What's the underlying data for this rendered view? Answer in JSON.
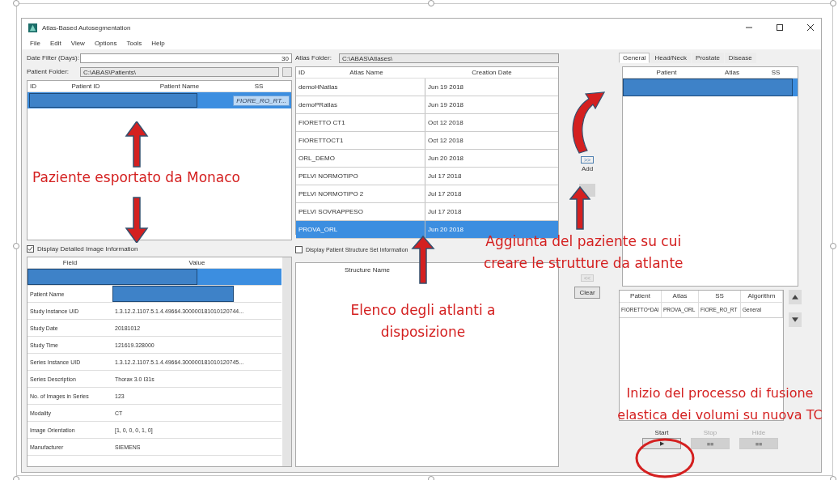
{
  "window": {
    "title": "Atlas-Based Autosegmentation"
  },
  "menu": [
    "File",
    "Edit",
    "View",
    "Options",
    "Tools",
    "Help"
  ],
  "date_filter": {
    "label": "Date Filter (Days):",
    "value": "30"
  },
  "patient_folder": {
    "label": "Patient Folder:",
    "value": "C:\\ABAS\\Patients\\"
  },
  "patients": {
    "columns": [
      "ID",
      "Patient ID",
      "Patient Name",
      "SS"
    ],
    "rows": [
      {
        "selected": true,
        "redacted": true,
        "ss": "FIORE_RO_RT..."
      }
    ]
  },
  "detailed_info": {
    "label": "Display Detailed Image Information",
    "checked": true,
    "columns": [
      "Field",
      "Value"
    ],
    "rows": [
      {
        "selected": true,
        "redacted": true
      },
      {
        "field": "Patient Name",
        "selected": false,
        "redacted": true
      },
      {
        "field": "Study Instance UID",
        "value": "1.3.12.2.1107.5.1.4.49664.300000181010120744...",
        "selected": false,
        "redacted": false
      },
      {
        "field": "Study Date",
        "value": "20181012",
        "selected": false,
        "redacted": false
      },
      {
        "field": "Study Time",
        "value": "121619.328000",
        "selected": false,
        "redacted": false
      },
      {
        "field": "Series Instance UID",
        "value": "1.3.12.2.1107.5.1.4.49664.300000181010120745...",
        "selected": false,
        "redacted": false
      },
      {
        "field": "Series Description",
        "value": "Thorax  3.0  I31s",
        "selected": false,
        "redacted": false
      },
      {
        "field": "No. of Images in Series",
        "value": "123",
        "selected": false,
        "redacted": false
      },
      {
        "field": "Modality",
        "value": "CT",
        "selected": false,
        "redacted": false
      },
      {
        "field": "Image Orientation",
        "value": "[1, 0, 0, 0, 1, 0]",
        "selected": false,
        "redacted": false
      },
      {
        "field": "Manufacturer",
        "value": "SIEMENS",
        "selected": false,
        "redacted": false
      }
    ]
  },
  "atlas_folder": {
    "label": "Atlas Folder:",
    "value": "C:\\ABAS\\Atlases\\"
  },
  "atlases": {
    "columns": [
      "ID",
      "Atlas Name",
      "Creation Date"
    ],
    "rows": [
      {
        "name": "demoHNatlas",
        "date": "Jun 19 2018",
        "selected": false
      },
      {
        "name": "demoPRatlas",
        "date": "Jun 19 2018",
        "selected": false
      },
      {
        "name": "FIORETTO CT1",
        "date": "Oct 12 2018",
        "selected": false
      },
      {
        "name": "FIORETTOCT1",
        "date": "Oct 12 2018",
        "selected": false
      },
      {
        "name": "ORL_DEMO",
        "date": "Jun 20 2018",
        "selected": false
      },
      {
        "name": "PELVI NORMOTIPO",
        "date": "Jul 17 2018",
        "selected": false
      },
      {
        "name": "PELVI NORMOTIPO 2",
        "date": "Jul 17 2018",
        "selected": false
      },
      {
        "name": "PELVI SOVRAPPESO",
        "date": "Jul 17 2018",
        "selected": false
      },
      {
        "name": "PROVA_ORL",
        "date": "Jun 20 2018",
        "selected": true
      }
    ]
  },
  "structure_info": {
    "label": "Display Patient Structure Set Information",
    "checked": false,
    "column": "Structure Name"
  },
  "add_button": {
    "icon": ">>",
    "label": "Add"
  },
  "remove_button": {
    "icon": "<<",
    "disabled": true
  },
  "clear_button": "Clear",
  "tabs": [
    {
      "label": "General",
      "selected": true
    },
    {
      "label": "Head/Neck",
      "selected": false
    },
    {
      "label": "Prostate",
      "selected": false
    },
    {
      "label": "Disease",
      "selected": false
    }
  ],
  "assignments": {
    "columns": [
      "Patient",
      "Atlas",
      "SS"
    ],
    "rows": [
      {
        "selected": true,
        "redacted": true
      }
    ]
  },
  "queue": {
    "columns": [
      "Patient",
      "Atlas",
      "SS",
      "Algorithm"
    ],
    "rows": [
      {
        "patient": "FIORETTO^DAI",
        "atlas": "PROVA_ORL",
        "ss": "FIORE_RO_RT",
        "algorithm": "General"
      }
    ]
  },
  "controls": [
    {
      "label": "Start",
      "icon": "▶",
      "disabled": false
    },
    {
      "label": "Stop",
      "icon": "■■",
      "disabled": true
    },
    {
      "label": "Hide",
      "icon": "■■",
      "disabled": true
    }
  ],
  "annotations": [
    {
      "kind": "text",
      "lines": [
        "Paziente esportato da Monaco"
      ]
    },
    {
      "kind": "text",
      "lines": [
        "Aggiunta del paziente su cui",
        "creare le strutture da atlante"
      ]
    },
    {
      "kind": "text",
      "lines": [
        "Elenco degli atlanti a",
        "disposizione"
      ]
    },
    {
      "kind": "text",
      "lines": [
        "Inizio del processo di fusione",
        "elastica dei volumi su nuova TC"
      ]
    }
  ]
}
